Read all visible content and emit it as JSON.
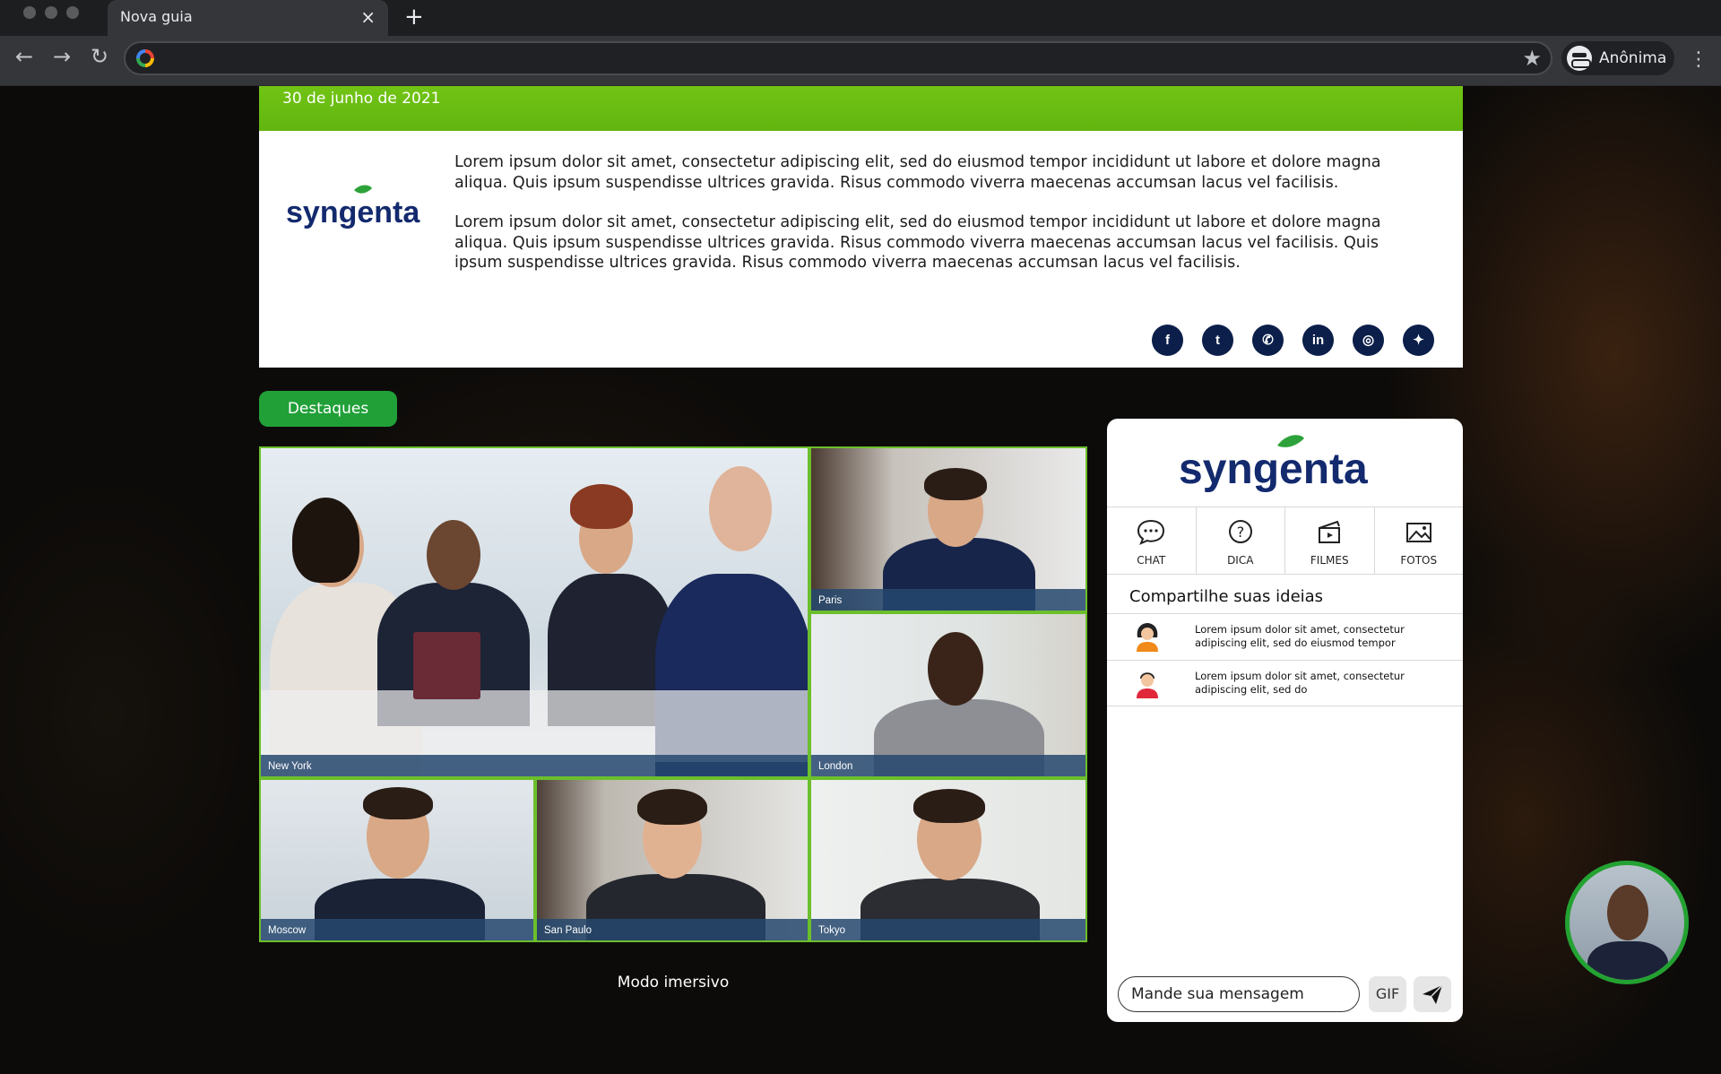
{
  "browser": {
    "tab_title": "Nova guia",
    "profile_label": "Anônima",
    "address_value": ""
  },
  "header": {
    "date": "30 de junho de 2021",
    "brand": "syngenta",
    "paragraph_1": "Lorem ipsum dolor sit amet, consectetur adipiscing elit, sed do eiusmod tempor incididunt ut labore et dolore magna aliqua. Quis ipsum suspendisse ultrices gravida. Risus commodo viverra maecenas accumsan lacus vel facilisis.",
    "paragraph_2": "Lorem ipsum dolor sit amet, consectetur adipiscing elit, sed do eiusmod tempor incididunt ut labore et dolore magna aliqua. Quis ipsum suspendisse ultrices gravida. Risus commodo viverra maecenas accumsan lacus vel facilisis.  Quis ipsum suspendisse ultrices gravida. Risus commodo viverra maecenas accumsan lacus vel facilisis.",
    "social": [
      {
        "icon": "facebook-icon",
        "glyph": "f"
      },
      {
        "icon": "tumblr-icon",
        "glyph": "t"
      },
      {
        "icon": "whatsapp-icon",
        "glyph": "✆"
      },
      {
        "icon": "linkedin-icon",
        "glyph": "in"
      },
      {
        "icon": "instagram-icon",
        "glyph": "◎"
      },
      {
        "icon": "twitter-icon",
        "glyph": "✦"
      }
    ]
  },
  "destaques_label": "Destaques",
  "video": {
    "tiles": [
      "New York",
      "Paris",
      "London",
      "Moscow",
      "San Paulo",
      "Tokyo"
    ],
    "immersive_label": "Modo imersivo"
  },
  "chat": {
    "brand": "syngenta",
    "tabs": [
      "CHAT",
      "DICA",
      "FILMES",
      "FOTOS"
    ],
    "title": "Compartilhe suas ideias",
    "messages": [
      "Lorem ipsum dolor sit amet, consectetur adipiscing elit, sed do eiusmod tempor",
      "Lorem ipsum dolor sit amet, consectetur adipiscing elit, sed do"
    ],
    "input_placeholder": "Mande sua mensagem",
    "gif_label": "GIF"
  },
  "colors": {
    "brand_green": "#21a038",
    "bar_green": "#6cbf1a",
    "brand_navy": "#0c1f4a"
  }
}
